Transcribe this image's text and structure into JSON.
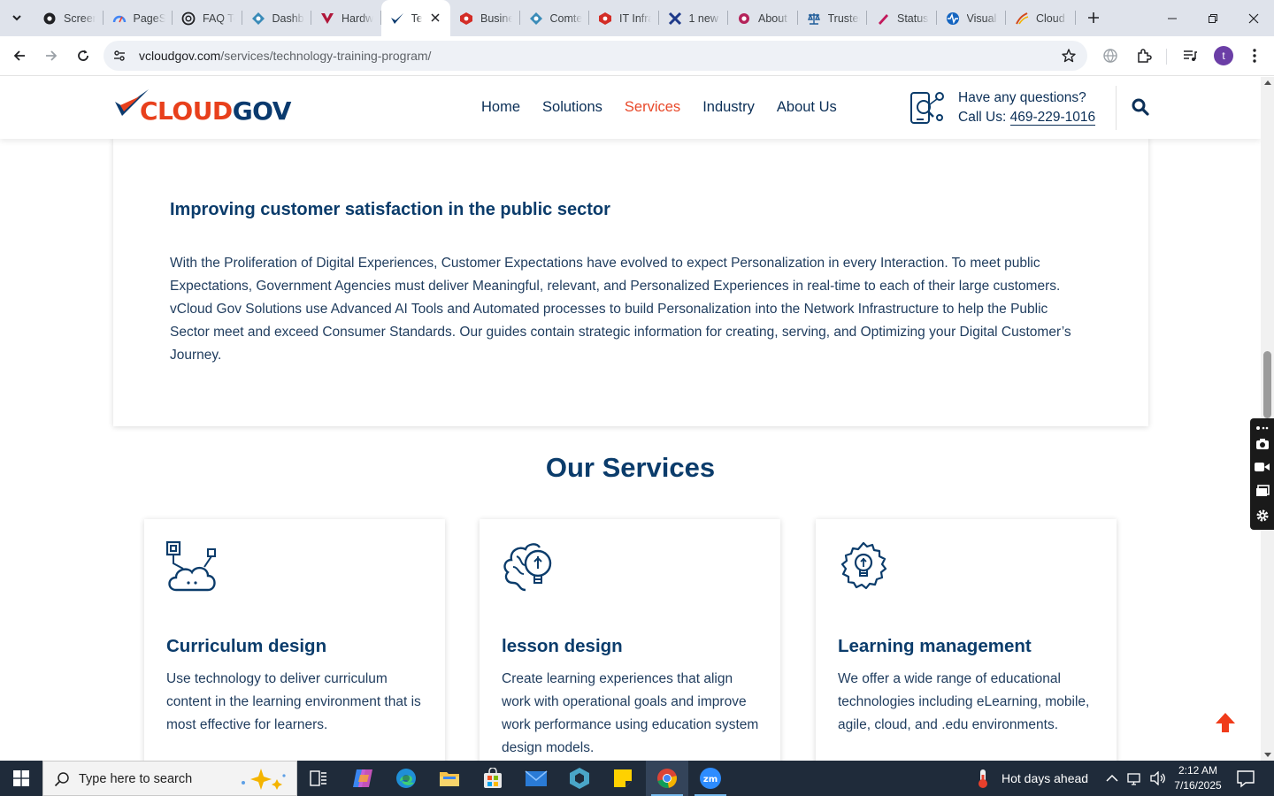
{
  "browser": {
    "tabs": [
      {
        "title": "Screencast",
        "icon": "screencastify-icon",
        "color": "#202124"
      },
      {
        "title": "PageSpeed",
        "icon": "pagespeed-icon",
        "color": "#4285f4"
      },
      {
        "title": "FAQ Tech",
        "icon": "openai-icon",
        "color": "#202124"
      },
      {
        "title": "Dashboard",
        "icon": "dashboard-icon",
        "color": "#3a8bb8"
      },
      {
        "title": "Hardware",
        "icon": "vercel-v-icon",
        "color": "#b0173a"
      },
      {
        "title": "Technology Training Program",
        "icon": "vcloudgov-icon",
        "color": "#0a3a6e",
        "active": true
      },
      {
        "title": "Business",
        "icon": "lastpass-icon",
        "color": "#d32d27"
      },
      {
        "title": "Comtech",
        "icon": "dashboard-icon",
        "color": "#3a8bb8"
      },
      {
        "title": "IT Infrastructure",
        "icon": "lastpass-icon",
        "color": "#d32d27"
      },
      {
        "title": "1 new",
        "icon": "x-cross-icon",
        "color": "#1e3a8a"
      },
      {
        "title": "About",
        "icon": "ring-icon",
        "color": "#b4235a"
      },
      {
        "title": "Trusted",
        "icon": "scales-icon",
        "color": "#1f5c99"
      },
      {
        "title": "Status",
        "icon": "pen-icon",
        "color": "#c2185b"
      },
      {
        "title": "Visual",
        "icon": "pulse-icon",
        "color": "#1565c0"
      },
      {
        "title": "Cloud",
        "icon": "cloud-slash-icon",
        "color": "#d2491c"
      }
    ],
    "url_domain": "vcloudgov.com",
    "url_path": "/services/technology-training-program/",
    "profile_initial": "t"
  },
  "site": {
    "logo_part1": "CLOUD",
    "logo_part2": "GOV",
    "nav": [
      {
        "label": "Home",
        "active": false
      },
      {
        "label": "Solutions",
        "active": false
      },
      {
        "label": "Services",
        "active": true
      },
      {
        "label": "Industry",
        "active": false
      },
      {
        "label": "About Us",
        "active": false
      }
    ],
    "contact_question": "Have any questions?",
    "contact_call_prefix": "Call Us: ",
    "contact_phone": "469-229-1016",
    "accent_color": "#e8492a",
    "brand_color": "#0b3c6b"
  },
  "intro": {
    "title": "Improving customer satisfaction in the public sector",
    "text": "With the Proliferation of Digital Experiences, Customer Expectations have evolved to expect Personalization in every Interaction. To meet public Expectations, Government Agencies must deliver Meaningful, relevant, and Personalized Experiences in real-time to each of their large customers. vCloud Gov Solutions use Advanced AI Tools and Automated processes to build Personalization into the Network Infrastructure to help the Public Sector meet and exceed Consumer Standards. Our guides contain strategic information for creating, serving, and Optimizing your Digital Customer’s Journey."
  },
  "services": {
    "heading": "Our Services",
    "cards": [
      {
        "title": "Curriculum design",
        "desc": "Use technology to deliver curriculum content in the learning environment that is most effective for learners.",
        "icon": "cloud-network-icon"
      },
      {
        "title": "lesson design",
        "desc": "Create learning experiences that align work with operational goals and improve work performance using education system design models.",
        "icon": "brain-bulb-icon"
      },
      {
        "title": "Learning management",
        "desc": "We offer a wide range of educational technologies including eLearning, mobile, agile, cloud, and .edu environments.",
        "icon": "bulb-gear-icon"
      }
    ]
  },
  "taskbar": {
    "search_placeholder": "Type here to search",
    "weather_text": "Hot days ahead",
    "time": "2:12 AM",
    "date": "7/16/2025"
  }
}
